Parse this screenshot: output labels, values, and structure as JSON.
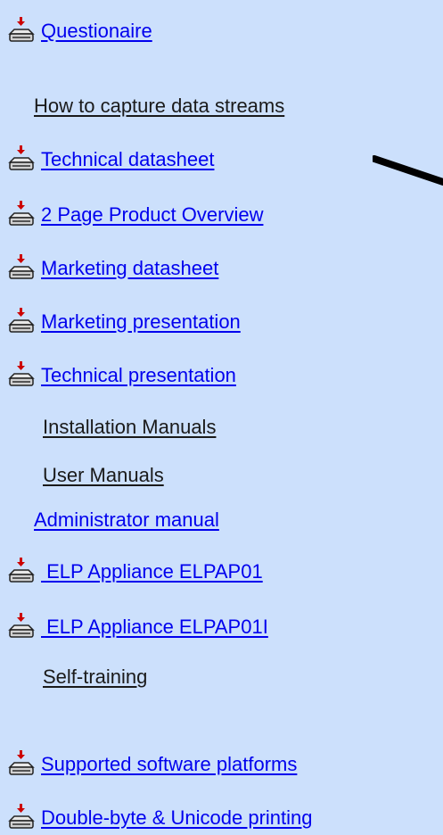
{
  "links": {
    "questionaire": "Questionaire",
    "how_to_capture": "How to capture data streams",
    "technical_datasheet": "Technical datasheet",
    "two_page_overview": "2 Page Product Overview",
    "marketing_datasheet": "Marketing datasheet",
    "marketing_presentation": "Marketing presentation",
    "technical_presentation": "Technical presentation",
    "installation_manuals": "Installation Manuals",
    "user_manuals": "User Manuals",
    "administrator_manual": "Administrator manual",
    "elp_appliance_1": " ELP Appliance ELPAP01",
    "elp_appliance_2": " ELP Appliance ELPAP01I",
    "self_training": "Self-training",
    "supported_platforms": "Supported software platforms",
    "double_byte": "Double-byte & Unicode printing"
  },
  "icons": {
    "download": "download-drive-icon",
    "pen": "pen-stroke-icon"
  },
  "colors": {
    "background": "#cce0fc",
    "link": "#0000ee",
    "plain_link": "#1a1a1a",
    "arrow": "#cc0000"
  }
}
